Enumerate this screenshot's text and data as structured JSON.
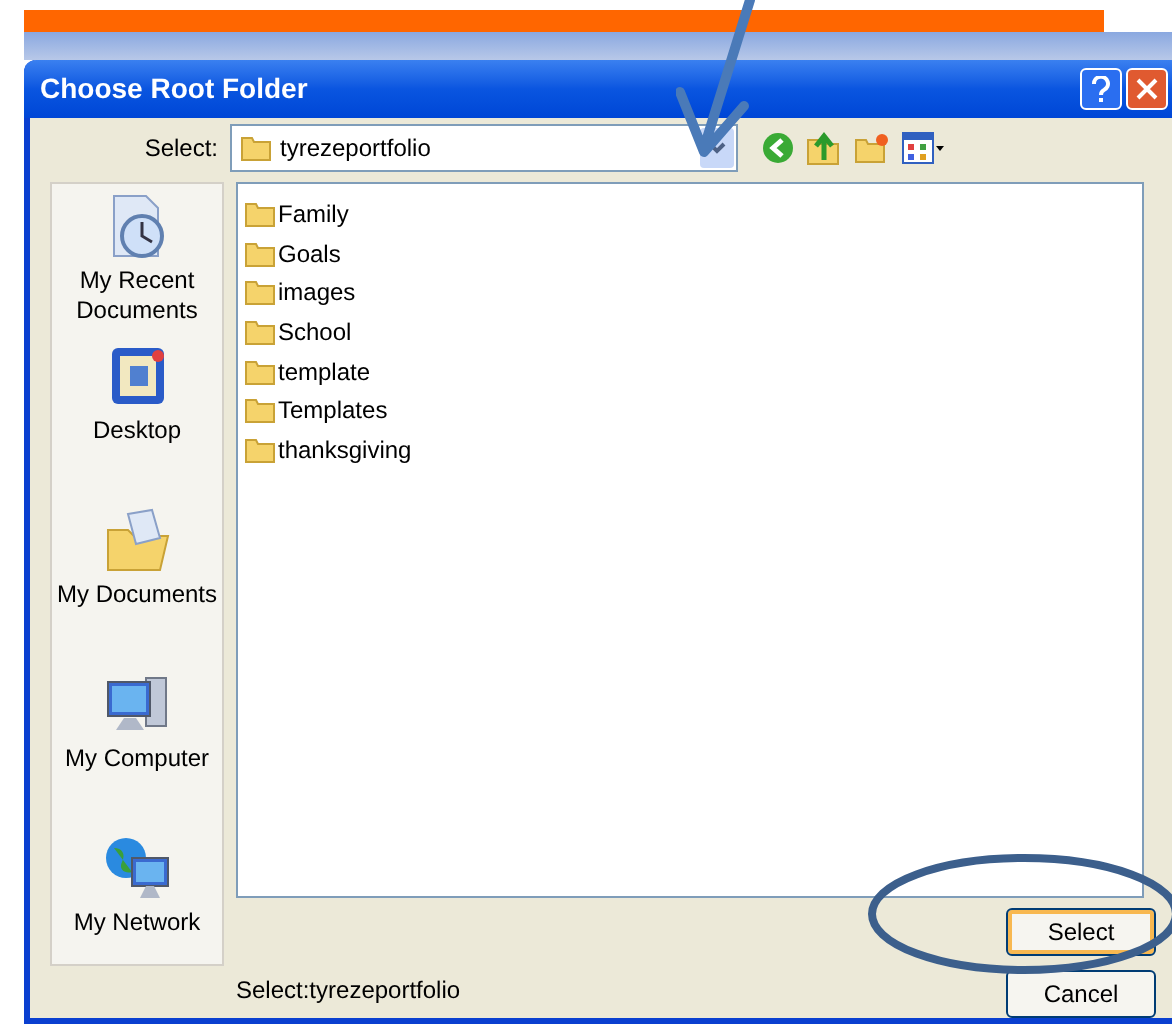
{
  "window": {
    "title": "Choose Root Folder"
  },
  "look_in": {
    "label": "Select:",
    "value": "tyrezeportfolio"
  },
  "places": [
    {
      "label": "My Recent Documents",
      "kind": "recent"
    },
    {
      "label": "Desktop",
      "kind": "desktop"
    },
    {
      "label": "My Documents",
      "kind": "documents"
    },
    {
      "label": "My Computer",
      "kind": "computer"
    },
    {
      "label": "My Network",
      "kind": "network"
    }
  ],
  "folders": [
    "Family",
    "Goals",
    "images",
    "School",
    "template",
    "Templates",
    "thanksgiving"
  ],
  "status": "Select:tyrezeportfolio",
  "buttons": [
    {
      "label": "Select",
      "default": true
    },
    {
      "label": "Cancel",
      "default": false
    }
  ]
}
